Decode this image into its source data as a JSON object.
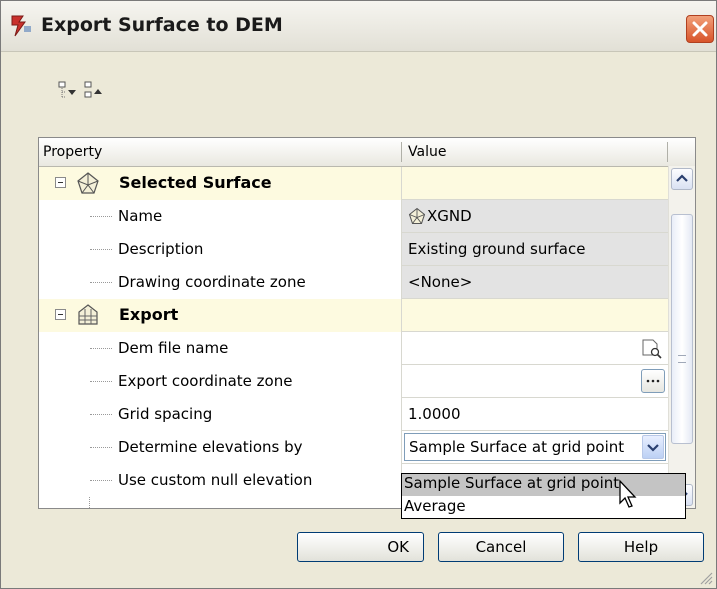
{
  "dialog": {
    "title": "Export Surface to DEM",
    "close_icon": "close-icon"
  },
  "toolbar": {
    "expand_icon": "expand-all-icon",
    "collapse_icon": "collapse-all-icon"
  },
  "grid": {
    "headers": {
      "property": "Property",
      "value": "Value"
    },
    "categories": [
      {
        "label": "Selected Surface",
        "icon": "surface-icon",
        "rows": [
          {
            "label": "Name",
            "value": "XGND",
            "value_icon": "surface-icon"
          },
          {
            "label": "Description",
            "value": "Existing ground surface"
          },
          {
            "label": "Drawing coordinate zone",
            "value": "<None>"
          }
        ]
      },
      {
        "label": "Export",
        "icon": "grid-surface-icon",
        "rows": [
          {
            "label": "Dem file name",
            "value": "",
            "button_icon": "browse-file-icon"
          },
          {
            "label": "Export coordinate zone",
            "value": "",
            "button_icon": "ellipsis-icon"
          },
          {
            "label": "Grid spacing",
            "value": "1.0000"
          },
          {
            "label": "Determine elevations by",
            "value": "Sample Surface at grid point"
          },
          {
            "label": "Use custom null elevation",
            "value": ""
          }
        ]
      }
    ]
  },
  "dropdown": {
    "options": [
      "Sample Surface at grid point",
      "Average"
    ],
    "highlighted": "Sample Surface at grid point"
  },
  "buttons": {
    "ok": "OK",
    "cancel": "Cancel",
    "help": "Help"
  },
  "colors": {
    "category_bg": "#fdfae0",
    "readonly_bg": "#e3e3e3",
    "dialog_bg": "#ece9d8"
  }
}
